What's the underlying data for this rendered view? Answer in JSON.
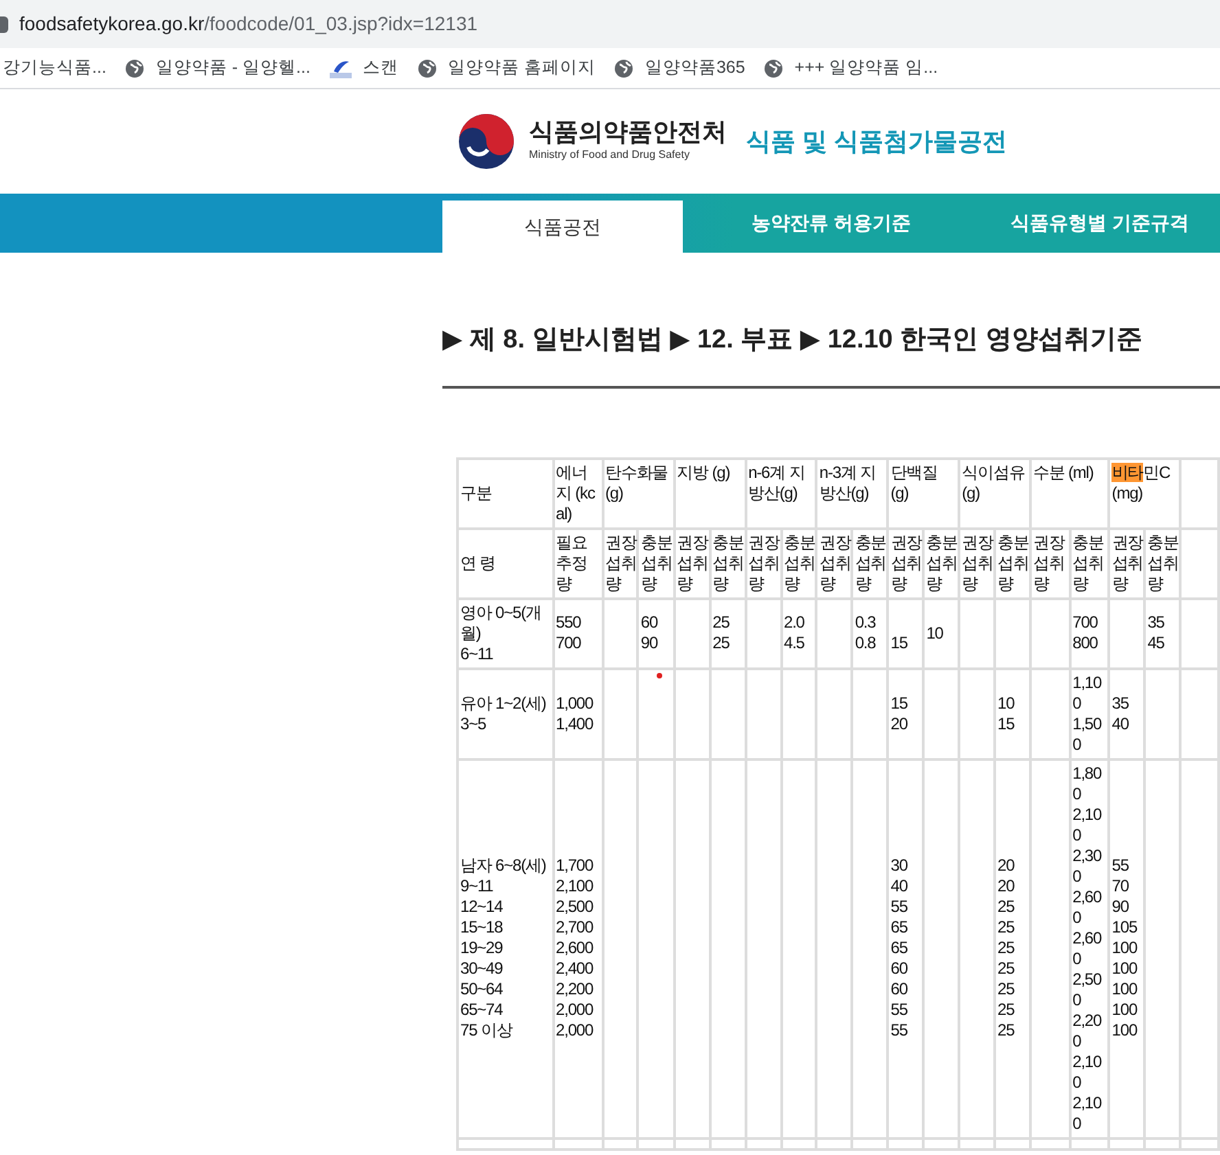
{
  "browser": {
    "url_domain": "foodsafetykorea.go.kr",
    "url_path": "/foodcode/01_03.jsp?idx=12131",
    "bookmarks": [
      {
        "label": "강기능식품...",
        "kind": "plain"
      },
      {
        "label": "일양약품 - 일양헬...",
        "kind": "site"
      },
      {
        "label": "스캔",
        "kind": "app"
      },
      {
        "label": "일양약품 홈페이지",
        "kind": "site"
      },
      {
        "label": "일양약품365",
        "kind": "site"
      },
      {
        "label": "+++ 일양약품 임...",
        "kind": "site"
      }
    ]
  },
  "header": {
    "agency": "식품의약품안전처",
    "agency_en": "Ministry of Food and Drug Safety",
    "site_title": "식품 및 식품첨가물공전"
  },
  "tabs": [
    {
      "label": "식품공전",
      "selected": true
    },
    {
      "label": "농약잔류 허용기준",
      "selected": false
    },
    {
      "label": "식품유형별 기준규격",
      "selected": false
    }
  ],
  "breadcrumb": "▶ 제 8. 일반시험법 ▶ 12. 부표 ▶ 12.10 한국인 영양섭취기준",
  "table": {
    "corner_top": "구분",
    "corner_bottom": "연 령",
    "groups": [
      {
        "parts": [
          {
            "text": "에너지 (kcal)",
            "highlight": false
          }
        ],
        "subs": [
          "필요추정량"
        ]
      },
      {
        "parts": [
          {
            "text": "탄수화물 (g)",
            "highlight": false
          }
        ],
        "subs": [
          "권장섭취량",
          "충분섭취량"
        ]
      },
      {
        "parts": [
          {
            "text": "지방 (g)",
            "highlight": false
          }
        ],
        "subs": [
          "권장섭취량",
          "충분섭취량"
        ]
      },
      {
        "parts": [
          {
            "text": "n-6계 지방산(g)",
            "highlight": false
          }
        ],
        "subs": [
          "권장섭취량",
          "충분섭취량"
        ]
      },
      {
        "parts": [
          {
            "text": "n-3계 지방산(g)",
            "highlight": false
          }
        ],
        "subs": [
          "권장섭취량",
          "충분섭취량"
        ]
      },
      {
        "parts": [
          {
            "text": "단백질 (g)",
            "highlight": false
          }
        ],
        "subs": [
          "권장섭취량",
          "충분섭취량"
        ]
      },
      {
        "parts": [
          {
            "text": "식이섬유 (g)",
            "highlight": false
          }
        ],
        "subs": [
          "권장섭취량",
          "충분섭취량"
        ]
      },
      {
        "parts": [
          {
            "text": "수분 (ml)",
            "highlight": false
          }
        ],
        "subs": [
          "권장섭취량",
          "충분섭취량"
        ]
      },
      {
        "parts": [
          {
            "text": "비타",
            "highlight": true
          },
          {
            "text": "민C (mg)",
            "highlight": false
          }
        ],
        "subs": [
          "권장섭취량",
          "충분섭취량"
        ]
      }
    ],
    "rows": [
      {
        "label": "영아 0~5(개월)\n6~11",
        "cells": [
          "550\n700",
          null,
          "60\n90",
          null,
          "25\n25",
          null,
          "2.0\n4.5",
          null,
          "0.3\n0.8",
          "\n15",
          "10\n",
          null,
          null,
          null,
          "700\n800",
          null,
          "35\n45"
        ]
      },
      {
        "label": "유아 1~2(세)\n3~5",
        "cells": [
          "1,000\n1,400",
          null,
          null,
          null,
          null,
          null,
          null,
          null,
          null,
          "15\n20",
          null,
          null,
          "10\n15",
          null,
          "1,100\n1,500",
          "35\n40",
          null
        ]
      },
      {
        "label": "남자 6~8(세)\n9~11\n12~14\n15~18\n19~29\n30~49\n50~64\n65~74\n75 이상",
        "cells": [
          "1,700\n2,100\n2,500\n2,700\n2,600\n2,400\n2,200\n2,000\n2,000",
          null,
          null,
          null,
          null,
          null,
          null,
          null,
          null,
          "30\n40\n55\n65\n65\n60\n60\n55\n55",
          null,
          null,
          "20\n20\n25\n25\n25\n25\n25\n25\n25",
          null,
          "1,800\n2,100\n2,300\n2,600\n2,600\n2,500\n2,200\n2,100\n2,100",
          "55\n70\n90\n105\n100\n100\n100\n100\n100",
          null
        ]
      }
    ]
  }
}
